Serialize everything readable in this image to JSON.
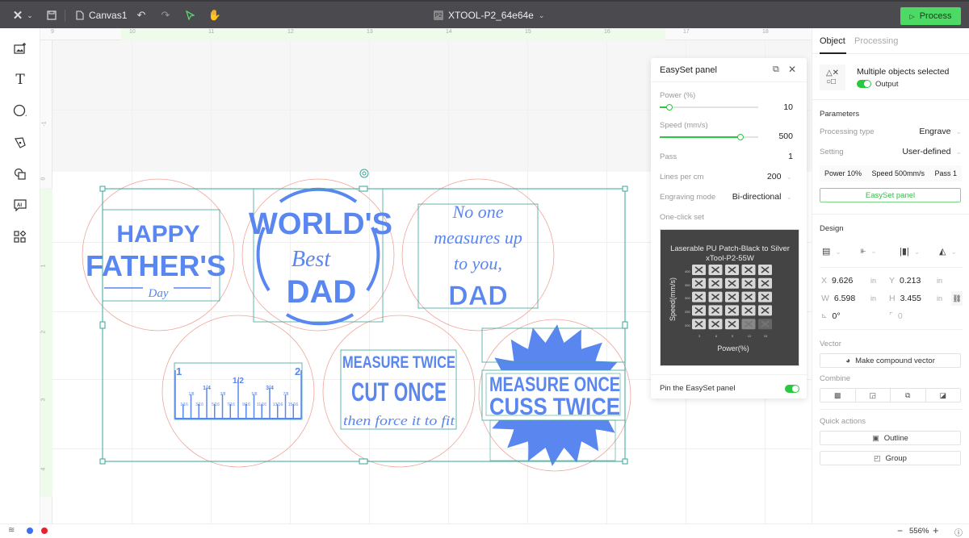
{
  "topbar": {
    "logo": "XTool logo",
    "canvas_name": "Canvas1",
    "device_badge": "P2",
    "device_name": "XTOOL-P2_64e64e",
    "process_label": "Process"
  },
  "ruler": {
    "top_ticks": [
      "9",
      "10",
      "11",
      "12",
      "13",
      "14",
      "15",
      "16",
      "17",
      "18"
    ],
    "left_ticks": [
      "-1",
      "0",
      "1",
      "2",
      "3",
      "4"
    ]
  },
  "left_tools": [
    {
      "name": "image",
      "icon": "image-add-icon"
    },
    {
      "name": "text",
      "icon": "text-icon"
    },
    {
      "name": "shape",
      "icon": "shape-icon"
    },
    {
      "name": "pen",
      "icon": "pen-icon"
    },
    {
      "name": "combine",
      "icon": "shapes-icon"
    },
    {
      "name": "ai",
      "icon": "ai-icon"
    },
    {
      "name": "apps",
      "icon": "apps-icon"
    }
  ],
  "designs": {
    "d1": {
      "line1": "HAPPY",
      "line2": "FATHER'S",
      "line3": "Day"
    },
    "d2": {
      "line1": "WORLD'S",
      "line2": "Best",
      "line3": "DAD"
    },
    "d3": {
      "line1": "No one",
      "line2": "measures up",
      "line3": "to you,",
      "line4": "DAD"
    },
    "d4": {
      "left": "1",
      "right": "2",
      "half": "1/2",
      "quarters": [
        "1/4",
        "3/4"
      ],
      "eighths": [
        "1/8",
        "3/8",
        "5/8",
        "7/8"
      ],
      "sixteenths": [
        "1/16",
        "3/16",
        "5/16",
        "7/16",
        "9/16",
        "11/16",
        "13/16",
        "15/16"
      ]
    },
    "d5": {
      "line1": "MEASURE TWICE",
      "line2": "CUT ONCE",
      "line3": "then force it to fit"
    },
    "d6": {
      "line1": "MEASURE ONCE",
      "line2": "CUSS TWICE"
    }
  },
  "easyset": {
    "title": "EasySet panel",
    "power_label": "Power (%)",
    "power_value": "10",
    "power_fraction": 0.1,
    "speed_label": "Speed (mm/s)",
    "speed_value": "500",
    "speed_fraction": 0.82,
    "pass_label": "Pass",
    "pass_value": "1",
    "lines_label": "Lines per cm",
    "lines_value": "200",
    "mode_label": "Engraving mode",
    "mode_value": "Bi-directional",
    "oneclick_label": "One-click set",
    "preview": {
      "title1": "Laserable PU Patch-Black to Silver",
      "title2": "xTool-P2-55W",
      "ylabel": "Speed(mm/s)",
      "xlabel": "Power(%)",
      "y_ticks": [
        "400",
        "350",
        "300",
        "250",
        "200"
      ],
      "x_ticks": [
        "3",
        "6",
        "9",
        "12",
        "15"
      ]
    },
    "pin_label": "Pin the EasySet panel",
    "pin_on": true
  },
  "right_panel": {
    "tab_object": "Object",
    "tab_processing": "Processing",
    "selection_title": "Multiple objects selected",
    "output_label": "Output",
    "output_on": true,
    "parameters_title": "Parameters",
    "processing_type_label": "Processing type",
    "processing_type_value": "Engrave",
    "setting_label": "Setting",
    "setting_value": "User-defined",
    "summary_power": "Power 10%",
    "summary_speed": "Speed 500mm/s",
    "summary_pass": "Pass 1",
    "easyset_button": "EasySet panel",
    "design_title": "Design",
    "x_label": "X",
    "x_value": "9.626",
    "x_unit": "in",
    "y_label": "Y",
    "y_value": "0.213",
    "y_unit": "in",
    "w_label": "W",
    "w_value": "6.598",
    "w_unit": "in",
    "h_label": "H",
    "h_value": "3.455",
    "h_unit": "in",
    "rotation_value": "0°",
    "corner_value": "0",
    "vector_title": "Vector",
    "compound_button": "Make compound vector",
    "combine_title": "Combine",
    "quick_title": "Quick actions",
    "outline_button": "Outline",
    "group_button": "Group"
  },
  "status": {
    "zoom": "556%",
    "colors": [
      "#3b6ff5",
      "#e8212a"
    ]
  }
}
